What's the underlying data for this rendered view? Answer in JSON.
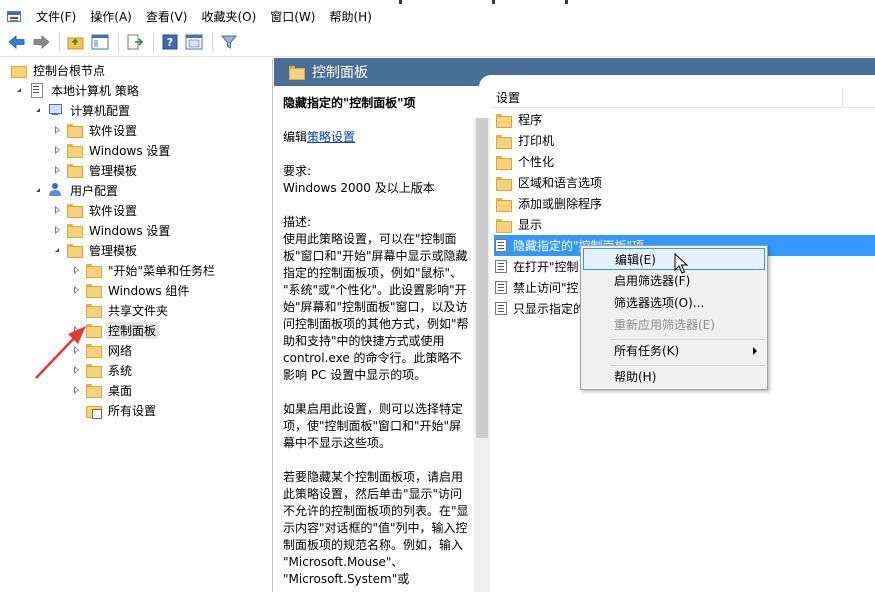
{
  "menu": [
    "文件(F)",
    "操作(A)",
    "查看(V)",
    "收藏夹(O)",
    "窗口(W)",
    "帮助(H)"
  ],
  "toolbar": {
    "icons": [
      "back-arrow-icon",
      "forward-arrow-icon",
      "up-folder-icon",
      "show-tree-icon",
      "export-icon",
      "help-icon",
      "properties-icon",
      "filter-icon"
    ]
  },
  "tree": {
    "root": "控制台根节点",
    "policy": "本地计算机 策略",
    "computer": "计算机配置",
    "c_software": "软件设置",
    "c_windows": "Windows 设置",
    "c_admin": "管理模板",
    "user": "用户配置",
    "u_software": "软件设置",
    "u_windows": "Windows 设置",
    "u_admin": "管理模板",
    "start": "\"开始\"菜单和任务栏",
    "wincomp": "Windows 组件",
    "shared": "共享文件夹",
    "control": "控制面板",
    "network": "网络",
    "system": "系统",
    "desktop": "桌面",
    "allsettings": "所有设置"
  },
  "panel": {
    "title": "控制面板"
  },
  "description": {
    "heading": "隐藏指定的\"控制面板\"项",
    "edit_prefix": "编辑",
    "edit_link": "策略设置",
    "req_label": "要求:",
    "req_value": "Windows 2000 及以上版本",
    "desc_label": "描述:",
    "lines1": [
      "使用此策略设置，可以在\"控制面",
      "板\"窗口和\"开始\"屏幕中显示或隐藏",
      "指定的控制面板项，例如\"鼠标\"、",
      "\"系统\"或\"个性化\"。此设置影响\"开",
      "始\"屏幕和\"控制面板\"窗口，以及访",
      "问控制面板项的其他方式，例如\"帮",
      "助和支持\"中的快捷方式或使用",
      "control.exe 的命令行。此策略不",
      "影响 PC 设置中显示的项。"
    ],
    "lines2": [
      "如果启用此设置，则可以选择特定",
      "项，使\"控制面板\"窗口和\"开始\"屏",
      "幕中不显示这些项。"
    ],
    "lines3": [
      "若要隐藏某个控制面板项，请启用",
      "此策略设置，然后单击\"显示\"访问",
      "不允许的控制面板项的列表。在\"显",
      "示内容\"对话框的\"值\"列中，输入控",
      "制面板项的规范名称。例如，输入",
      "\"Microsoft.Mouse\"、",
      "\"Microsoft.System\"或"
    ]
  },
  "list": {
    "col_setting": "设置",
    "folders": [
      "程序",
      "打印机",
      "个性化",
      "区域和语言选项",
      "添加或删除程序",
      "显示"
    ],
    "settings": [
      "隐藏指定的\"控制面板\"项",
      "在打开\"控制",
      "禁止访问\"控",
      "只显示指定的"
    ]
  },
  "context_menu": {
    "edit": "编辑(E)",
    "enable_filter": "启用筛选器(F)",
    "filter_options": "筛选器选项(O)...",
    "reapply_filter": "重新应用筛选器(E)",
    "all_tasks": "所有任务(K)",
    "help": "帮助(H)"
  }
}
